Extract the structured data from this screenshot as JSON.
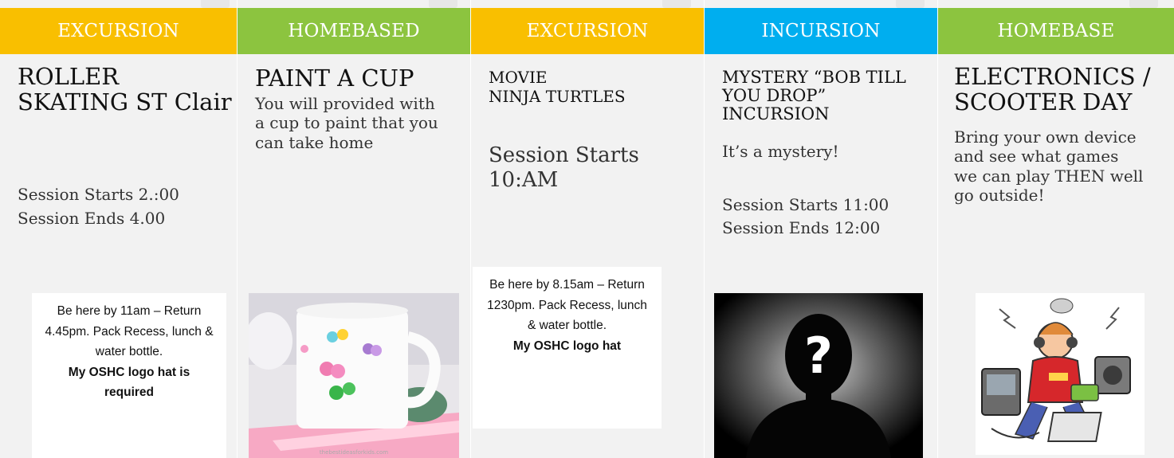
{
  "colors": {
    "excursion": "#f9bf00",
    "homebased": "#8cc43f",
    "incursion": "#00aeef",
    "panel": "#f2f2f2"
  },
  "columns": [
    {
      "header": "EXCURSION",
      "title": "ROLLER SKATING  ST Clair",
      "session_starts": "Session Starts 2.:00",
      "session_ends": "Session Ends 4.00",
      "note_lines": [
        "Be here by 11am – Return 4.45pm. Pack Recess, lunch & water bottle."
      ],
      "note_bold": "My OSHC logo hat is required"
    },
    {
      "header": "HOMEBASED",
      "title": "PAINT A CUP",
      "description": "You will provided with a cup to paint that you can take home",
      "image_caption": "thebestideasforkids.com",
      "image_icon": "painted-cup-image"
    },
    {
      "header": "EXCURSION",
      "title_line1": "MOVIE",
      "title_line2": "NINJA TURTLES",
      "session_starts": "Session Starts 10:AM",
      "note_lines": [
        "Be here by 8.15am – Return 1230pm. Pack Recess, lunch & water bottle."
      ],
      "note_bold": "My OSHC logo hat"
    },
    {
      "header": "INCURSION",
      "title": "MYSTERY  “BOB TILL YOU DROP” INCURSION",
      "description": "It’s a mystery!",
      "session_starts": "Session Starts  11:00",
      "session_ends": "Session Ends 12:00",
      "image_icon": "mystery-silhouette-image"
    },
    {
      "header": "HOMEBASE",
      "title": "ELECTRONICS / SCOOTER DAY",
      "description": "Bring your own device and see what games we can play THEN well go outside!",
      "image_icon": "electronics-kid-clipart"
    }
  ]
}
